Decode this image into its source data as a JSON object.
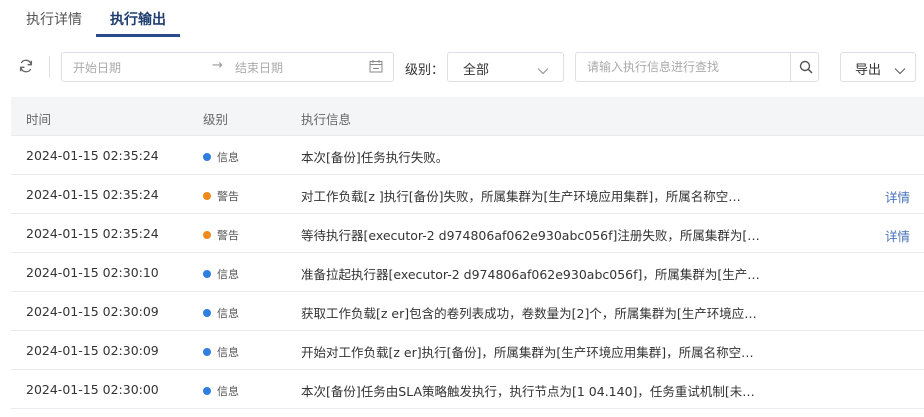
{
  "tabs": [
    {
      "label": "执行详情",
      "active": false
    },
    {
      "label": "执行输出",
      "active": true
    }
  ],
  "toolbar": {
    "refresh_icon": "refresh-icon",
    "date_start_placeholder": "开始日期",
    "date_arrow": "→",
    "date_end_placeholder": "结束日期",
    "calendar_icon": "calendar-icon",
    "level_label": "级别：",
    "level_value": "全部",
    "search_placeholder": "请输入执行信息进行查找",
    "search_icon": "search-icon",
    "export_label": "导出"
  },
  "table": {
    "headers": [
      "时间",
      "级别",
      "执行信息"
    ],
    "rows": [
      {
        "time": "2024-01-15 02:35:24",
        "level": "信息",
        "level_color": "#2f7ee0",
        "message": "本次[备份]任务执行失败。",
        "detail": ""
      },
      {
        "time": "2024-01-15 02:35:24",
        "level": "警告",
        "level_color": "#f08a1c",
        "message": "对工作负载[z          ]执行[备份]失败，所属集群为[生产环境应用集群]，所属名称空…",
        "detail": "详情"
      },
      {
        "time": "2024-01-15 02:35:24",
        "level": "警告",
        "level_color": "#f08a1c",
        "message": "等待执行器[executor-2               d974806af062e930abc056f]注册失败，所属集群为[…",
        "detail": "详情"
      },
      {
        "time": "2024-01-15 02:30:10",
        "level": "信息",
        "level_color": "#2f7ee0",
        "message": "准备拉起执行器[executor-2               d974806af062e930abc056f]，所属集群为[生产…",
        "detail": ""
      },
      {
        "time": "2024-01-15 02:30:09",
        "level": "信息",
        "level_color": "#2f7ee0",
        "message": "获取工作负载[z         er]包含的卷列表成功，卷数量为[2]个，所属集群为[生产环境应…",
        "detail": ""
      },
      {
        "time": "2024-01-15 02:30:09",
        "level": "信息",
        "level_color": "#2f7ee0",
        "message": "开始对工作负载[z         er]执行[备份]，所属集群为[生产环境应用集群]，所属名称空…",
        "detail": ""
      },
      {
        "time": "2024-01-15 02:30:00",
        "level": "信息",
        "level_color": "#2f7ee0",
        "message": "本次[备份]任务由SLA策略触发执行，执行节点为[1            04.140]，任务重试机制[未…",
        "detail": ""
      }
    ]
  },
  "colors": {
    "accent": "#2b4c8c",
    "info": "#2f7ee0",
    "warning": "#f08a1c",
    "link": "#4a72b8"
  }
}
